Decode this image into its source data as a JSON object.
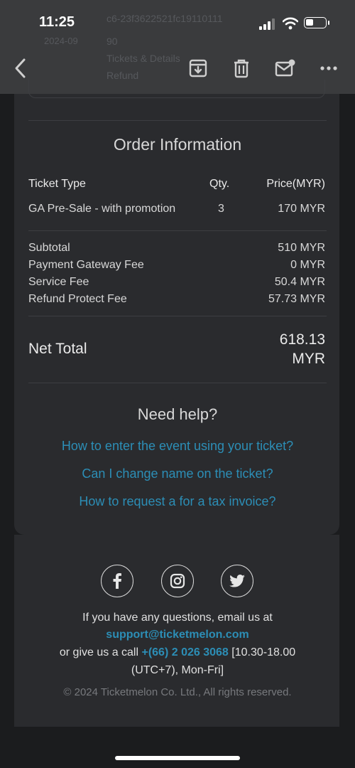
{
  "status_bar": {
    "time": "11:25"
  },
  "background_text": {
    "lines": [
      "c6-23f3622521fc19110111",
      "90",
      "Tickets & Details",
      "Refund"
    ],
    "left": "2024-09"
  },
  "toolbar": {},
  "order": {
    "title": "Order Information",
    "headers": {
      "type": "Ticket Type",
      "qty": "Qty.",
      "price": "Price(MYR)"
    },
    "item": {
      "type": "GA Pre-Sale - with promotion",
      "qty": "3",
      "price": "170 MYR"
    },
    "fees": [
      {
        "label": "Subtotal",
        "value": "510 MYR"
      },
      {
        "label": "Payment Gateway Fee",
        "value": "0 MYR"
      },
      {
        "label": "Service Fee",
        "value": "50.4 MYR"
      },
      {
        "label": "Refund Protect Fee",
        "value": "57.73 MYR"
      }
    ],
    "net_label": "Net Total",
    "net_value_line1": "618.13",
    "net_value_line2": "MYR"
  },
  "help": {
    "title": "Need help?",
    "links": [
      "How to enter the event using your ticket?",
      "Can I change name on the ticket?",
      "How to request a for a tax invoice?"
    ]
  },
  "footer": {
    "line1": "If you have any questions, email us at",
    "email": "support@ticketmelon.com",
    "call_prefix": "or give us a call ",
    "phone": "+(66) 2 026 3068",
    "hours_part1": " [10.30-18.00",
    "hours_part2": "(UTC+7), Mon-Fri]",
    "copyright": "© 2024 Ticketmelon Co. Ltd., All rights reserved."
  },
  "social": [
    "facebook-icon",
    "instagram-icon",
    "twitter-icon"
  ]
}
